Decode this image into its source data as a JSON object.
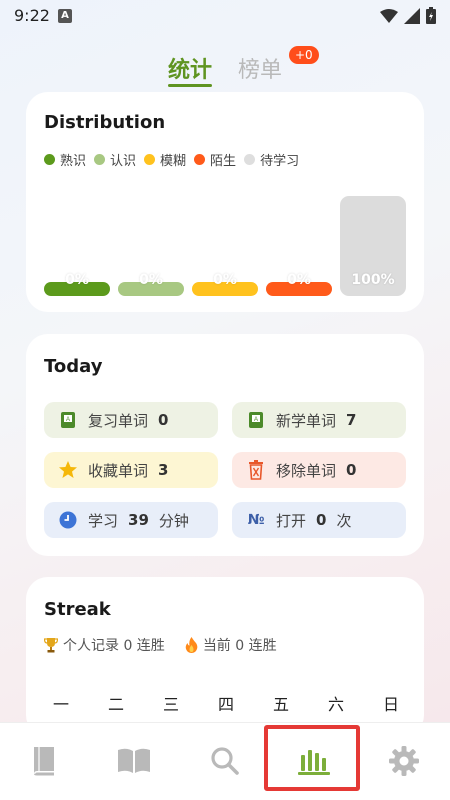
{
  "status_bar": {
    "time": "9:22",
    "badge": "A"
  },
  "tabs": {
    "stats_label": "统计",
    "ranking_label": "榜单",
    "ranking_badge": "+0"
  },
  "distribution": {
    "title": "Distribution",
    "legend": [
      {
        "label": "熟识",
        "color": "#5c9a1c"
      },
      {
        "label": "认识",
        "color": "#a8c882"
      },
      {
        "label": "模糊",
        "color": "#ffc21e"
      },
      {
        "label": "陌生",
        "color": "#ff5a1a"
      },
      {
        "label": "待学习",
        "color": "#dedede"
      }
    ],
    "bars": [
      {
        "label": "0%",
        "value": 0,
        "color": "#5c9a1c"
      },
      {
        "label": "0%",
        "value": 0,
        "color": "#a8c882"
      },
      {
        "label": "0%",
        "value": 0,
        "color": "#ffc21e"
      },
      {
        "label": "0%",
        "value": 0,
        "color": "#ff5a1a"
      },
      {
        "label": "100%",
        "value": 100,
        "color": "#dcdcdc"
      }
    ]
  },
  "today": {
    "title": "Today",
    "items": [
      {
        "label": "复习单词",
        "value": "0",
        "bg": "#eef2e4",
        "icon": "book-icon"
      },
      {
        "label": "新学单词",
        "value": "7",
        "bg": "#eef2e4",
        "icon": "book-icon"
      },
      {
        "label": "收藏单词",
        "value": "3",
        "bg": "#fdf6d3",
        "icon": "star-icon"
      },
      {
        "label": "移除单词",
        "value": "0",
        "bg": "#fde9e4",
        "icon": "trash-icon"
      },
      {
        "label": "学习",
        "value": "39",
        "suffix": "分钟",
        "bg": "#e8eef9",
        "icon": "clock-icon"
      },
      {
        "label": "打开",
        "value": "0",
        "suffix": "次",
        "bg": "#e8eef9",
        "icon": "number-icon"
      }
    ]
  },
  "streak": {
    "title": "Streak",
    "record": "个人记录 0 连胜",
    "current": "当前 0 连胜",
    "weekdays": [
      "一",
      "二",
      "三",
      "四",
      "五",
      "六",
      "日"
    ]
  },
  "bottom_nav": {
    "items": [
      {
        "icon": "book-icon",
        "active": false
      },
      {
        "icon": "open-book-icon",
        "active": false
      },
      {
        "icon": "search-icon",
        "active": false
      },
      {
        "icon": "bar-chart-icon",
        "active": true
      },
      {
        "icon": "gear-icon",
        "active": false
      }
    ],
    "active_color": "#7cae3a",
    "inactive_color": "#b9b9b9"
  }
}
